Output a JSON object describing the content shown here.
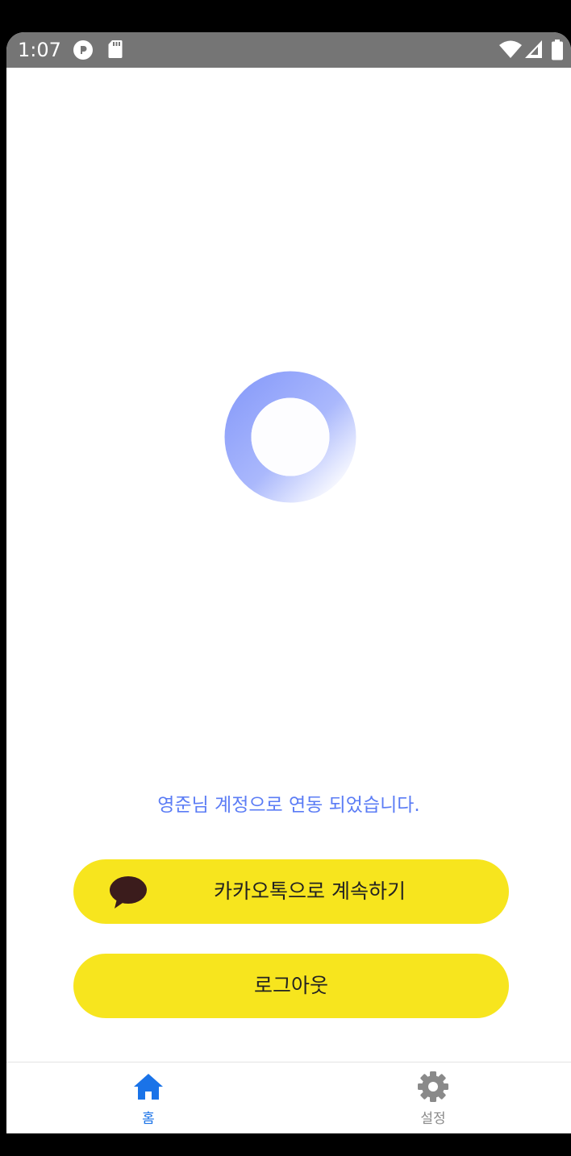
{
  "status_bar": {
    "time": "1:07",
    "icons": [
      "pocket-app-icon",
      "sd-card-icon",
      "wifi-icon",
      "cell-signal-icon",
      "battery-icon"
    ]
  },
  "loader": {
    "icon": "loading-spinner-icon",
    "gradient_colors": [
      "#8a9dfa",
      "#ffffff"
    ]
  },
  "message": {
    "text": "영준님 계정으로 연동 되었습니다.",
    "color": "#5b7cf5"
  },
  "buttons": {
    "kakao": {
      "label": "카카오톡으로 계속하기",
      "icon": "kakao-bubble-icon"
    },
    "logout": {
      "label": "로그아웃"
    }
  },
  "nav": {
    "items": [
      {
        "label": "홈",
        "icon": "home-icon",
        "active": true
      },
      {
        "label": "설정",
        "icon": "gear-icon",
        "active": false
      }
    ]
  },
  "colors": {
    "accent": "#1a73e8",
    "button_yellow": "#f7e51e",
    "status_bar": "#757575",
    "inactive": "#8a8a8a"
  }
}
